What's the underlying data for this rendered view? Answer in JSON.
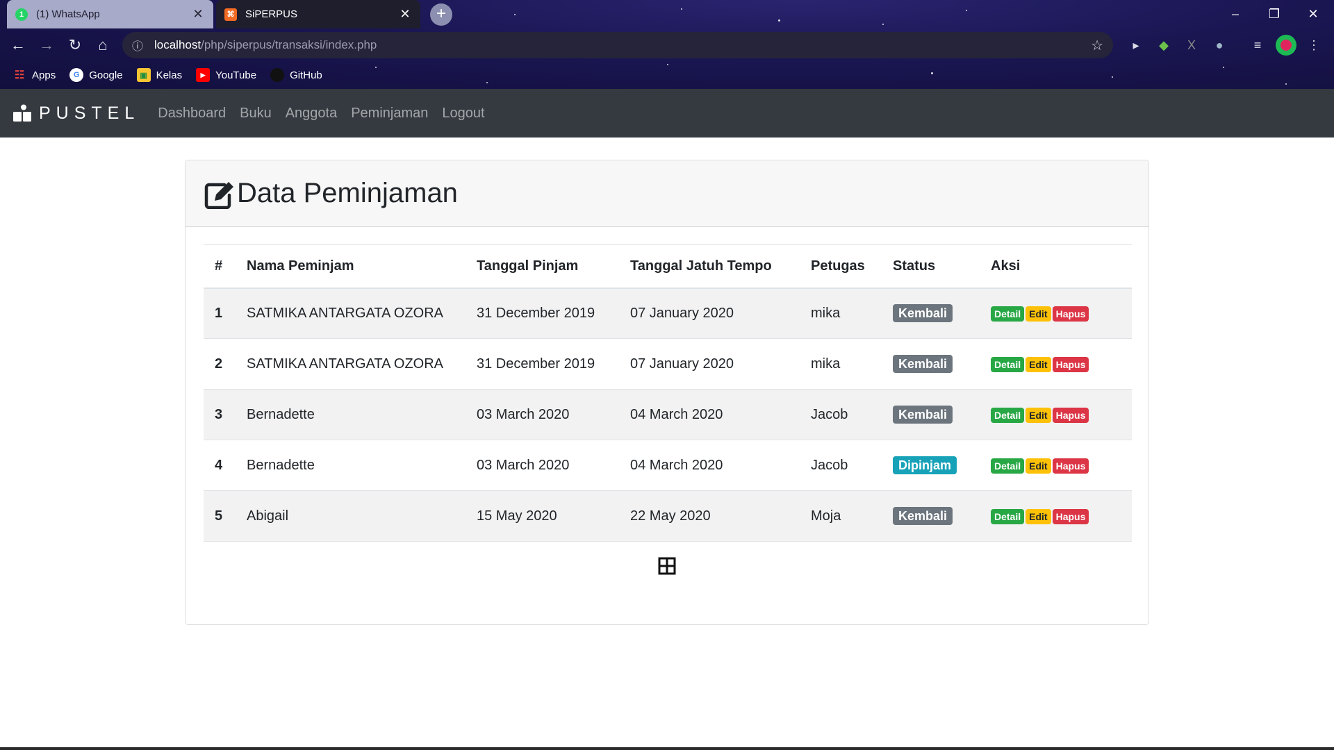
{
  "browser": {
    "tabs": [
      {
        "title": "(1) WhatsApp",
        "favicon_badge": "1",
        "state": "inactive"
      },
      {
        "title": "SiPERPUS",
        "state": "active"
      }
    ],
    "address": {
      "host": "localhost",
      "path": "/php/siperpus/transaksi/index.php"
    },
    "bookmarks": [
      "Apps",
      "Google",
      "Kelas",
      "YouTube",
      "GitHub"
    ]
  },
  "navbar": {
    "brand": "PUSTEL",
    "links": [
      "Dashboard",
      "Buku",
      "Anggota",
      "Peminjaman",
      "Logout"
    ]
  },
  "page": {
    "title": "Data Peminjaman",
    "headers": [
      "#",
      "Nama Peminjam",
      "Tanggal Pinjam",
      "Tanggal Jatuh Tempo",
      "Petugas",
      "Status",
      "Aksi"
    ],
    "rows": [
      {
        "num": "1",
        "nama": "SATMIKA ANTARGATA OZORA",
        "pinjam": "31 December 2019",
        "tempo": "07 January 2020",
        "petugas": "mika",
        "status": "Kembali"
      },
      {
        "num": "2",
        "nama": "SATMIKA ANTARGATA OZORA",
        "pinjam": "31 December 2019",
        "tempo": "07 January 2020",
        "petugas": "mika",
        "status": "Kembali"
      },
      {
        "num": "3",
        "nama": "Bernadette",
        "pinjam": "03 March 2020",
        "tempo": "04 March 2020",
        "petugas": "Jacob",
        "status": "Kembali"
      },
      {
        "num": "4",
        "nama": "Bernadette",
        "pinjam": "03 March 2020",
        "tempo": "04 March 2020",
        "petugas": "Jacob",
        "status": "Dipinjam"
      },
      {
        "num": "5",
        "nama": "Abigail",
        "pinjam": "15 May 2020",
        "tempo": "22 May 2020",
        "petugas": "Moja",
        "status": "Kembali"
      }
    ],
    "actions": {
      "detail": "Detail",
      "edit": "Edit",
      "hapus": "Hapus"
    }
  },
  "colors": {
    "navbar_bg": "#343a40",
    "kembali": "#6c757d",
    "dipinjam": "#17a2b8",
    "detail": "#28a745",
    "edit": "#ffc107",
    "hapus": "#dc3545"
  }
}
